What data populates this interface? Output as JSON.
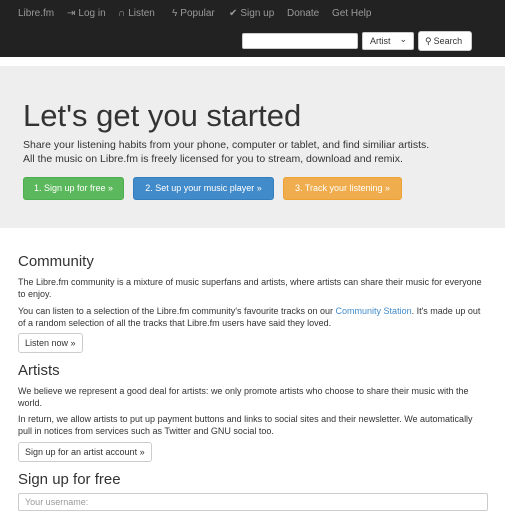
{
  "nav": {
    "brand": "Libre.fm",
    "login": "Log in",
    "listen": "Listen",
    "popular": "Popular",
    "signup": "Sign up",
    "donate": "Donate",
    "get_help": "Get Help"
  },
  "search": {
    "value": "",
    "type_selected": "Artist",
    "button_label": "Search"
  },
  "jumbotron": {
    "title": "Let's get you started",
    "lead_line1": "Share your listening habits from your phone, computer or tablet, and find similiar artists.",
    "lead_line2": "All the music on Libre.fm is freely licensed for you to stream, download and remix.",
    "step1": "1. Sign up for free »",
    "step2": "2. Set up your music player »",
    "step3": "3. Track your listening »"
  },
  "community": {
    "heading": "Community",
    "para1": "The Libre.fm community is a mixture of music superfans and artists, where artists can share their music for everyone to enjoy.",
    "para2_before": "You can listen to a selection of the Libre.fm community's favourite tracks on our ",
    "para2_link": "Community Station",
    "para2_after": ". It's made up out of a random selection of all the tracks that Libre.fm users have said they loved.",
    "button": "Listen now »"
  },
  "artists": {
    "heading": "Artists",
    "para1": "We believe we represent a good deal for artists: we only promote artists who choose to share their music with the world.",
    "para2": "In return, we allow artists to put up payment buttons and links to social sites and their newsletter. We automatically pull in notices from services such as Twitter and GNU social too.",
    "button": "Sign up for an artist account »"
  },
  "signup": {
    "heading": "Sign up for free",
    "username_placeholder": "Your username:"
  },
  "colors": {
    "navbar": "#222222",
    "jumbotron": "#eeeeee",
    "success": "#5cb85c",
    "primary": "#428bca",
    "warning": "#f0ad4e",
    "link": "#428bca"
  }
}
